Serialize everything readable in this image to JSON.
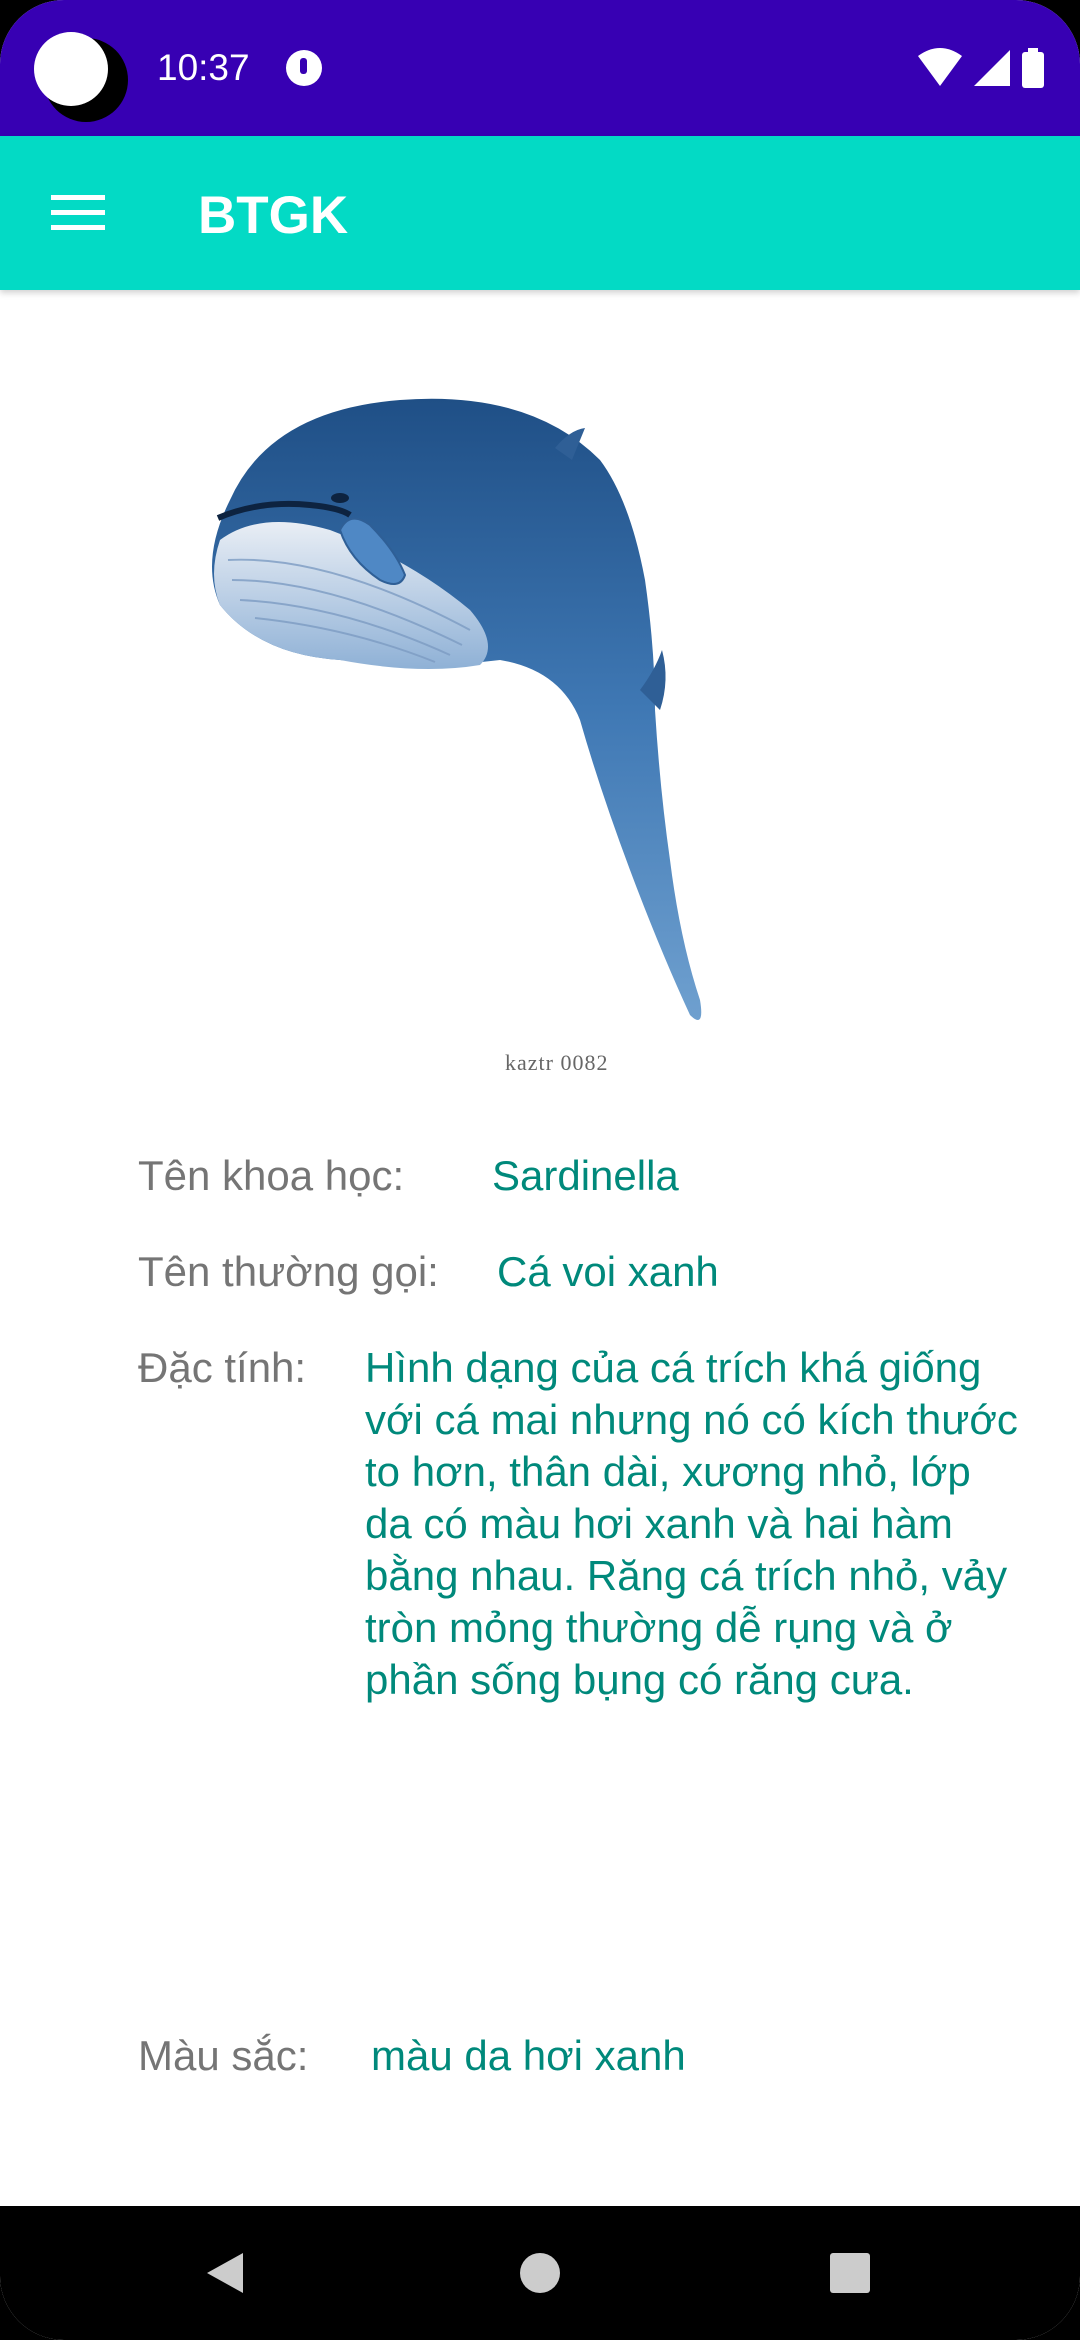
{
  "status_bar": {
    "time": "10:37",
    "icons": [
      "wifi-icon",
      "cell-signal-icon",
      "battery-icon"
    ]
  },
  "app_bar": {
    "title": "BTGK",
    "menu_icon": "hamburger-menu-icon",
    "background_color": "#03dac5"
  },
  "image": {
    "caption": "kaztr 0082"
  },
  "details": {
    "scientific_name": {
      "label": "Tên khoa học:",
      "value": "Sardinella"
    },
    "common_name": {
      "label": "Tên thường gọi:",
      "value": "Cá voi xanh"
    },
    "characteristics": {
      "label": "Đặc tính:",
      "value": "Hình dạng của cá trích khá giống với cá mai nhưng nó có kích thước to hơn, thân dài, xương nhỏ, lớp da có màu hơi xanh và hai hàm bằng nhau. Răng cá trích nhỏ, vảy tròn mỏng thường dễ rụng và ở phần sống bụng có răng cưa."
    },
    "color": {
      "label": "Màu sắc:",
      "value": "màu da hơi xanh"
    }
  },
  "colors": {
    "status_bar": "#3700b3",
    "label_text": "#757575",
    "value_text": "#00897b"
  },
  "nav_bar": {
    "icons": [
      "back-icon",
      "home-icon",
      "recents-icon"
    ]
  }
}
